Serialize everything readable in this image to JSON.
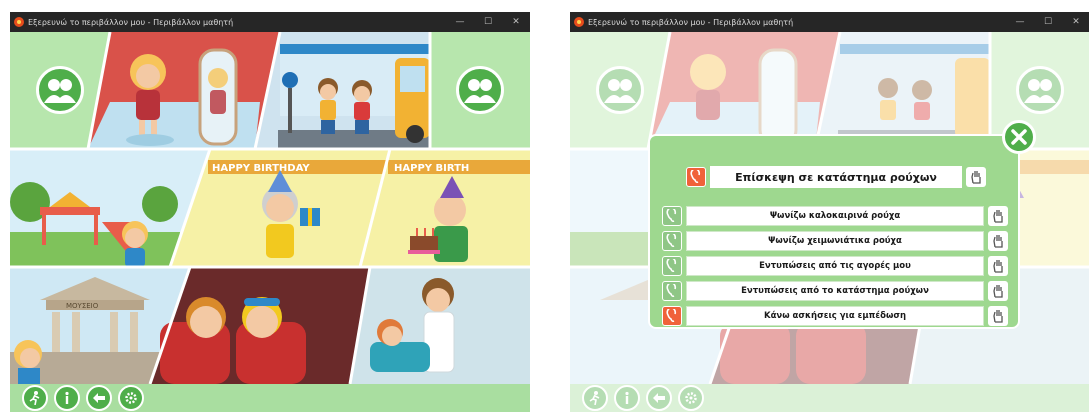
{
  "window": {
    "title": "Εξερευνώ το περιβάλλον μου - Περιβάλλον μαθητή",
    "minimize_glyph": "—",
    "maximize_glyph": "☐",
    "close_glyph": "✕"
  },
  "scenes": [
    {
      "name": "bathroom-mirror-scene"
    },
    {
      "name": "bus-stop-scene"
    },
    {
      "name": "playground-scene"
    },
    {
      "name": "birthday-gift-scene"
    },
    {
      "name": "birthday-cake-scene"
    },
    {
      "name": "museum-scene"
    },
    {
      "name": "cinema-scene"
    },
    {
      "name": "dentist-scene"
    }
  ],
  "banner": {
    "left_text": "HAPPY BIRTHDAY",
    "right_text": "HAPPY BIRTH",
    "museum_sign": "ΜΟΥΣΕΙΟ"
  },
  "side_buttons": {
    "left_icon": "two-people-icon",
    "right_icon": "two-people-icon"
  },
  "bottom_bar": {
    "buttons": [
      {
        "icon": "exit-runner-icon"
      },
      {
        "icon": "info-icon"
      },
      {
        "icon": "back-arrow-icon"
      },
      {
        "icon": "settings-gear-icon"
      }
    ]
  },
  "dialog": {
    "title": "Επίσκεψη σε κατάστημα ρούχων",
    "options": [
      {
        "label": "Ψωνίζω καλοκαιρινά ρούχα",
        "active": false
      },
      {
        "label": "Ψωνίζω χειμωνιάτικα ρούχα",
        "active": false
      },
      {
        "label": "Εντυπώσεις από τις αγορές μου",
        "active": false
      },
      {
        "label": "Εντυπώσεις από το κατάστημα ρούχων",
        "active": false
      },
      {
        "label": "Κάνω ασκήσεις για εμπέδωση",
        "active": true
      }
    ],
    "close_icon": "close-x-icon"
  },
  "colors": {
    "accent_green": "#4fae4a",
    "panel_green": "#a9dea0",
    "active_orange": "#f0623a",
    "titlebar": "#262626"
  }
}
